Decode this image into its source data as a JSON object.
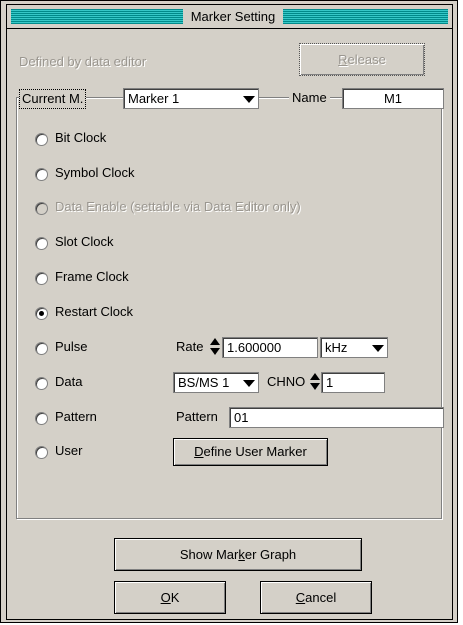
{
  "window": {
    "title": "Marker Setting"
  },
  "defined_label": "Defined by data editor",
  "release_button": {
    "prefix": "",
    "accel": "R",
    "rest": "elease"
  },
  "current_marker": {
    "label": "Current M.",
    "value": "Marker 1"
  },
  "name": {
    "label": "Name",
    "value": "M1"
  },
  "options": [
    {
      "label": "Bit Clock",
      "checked": false,
      "disabled": false
    },
    {
      "label": "Symbol Clock",
      "checked": false,
      "disabled": false
    },
    {
      "label": "Data Enable (settable via Data Editor only)",
      "checked": false,
      "disabled": true
    },
    {
      "label": "Slot Clock",
      "checked": false,
      "disabled": false
    },
    {
      "label": "Frame Clock",
      "checked": false,
      "disabled": false
    },
    {
      "label": "Restart Clock",
      "checked": true,
      "disabled": false
    },
    {
      "label": "Pulse",
      "checked": false,
      "disabled": false
    },
    {
      "label": "Data",
      "checked": false,
      "disabled": false
    },
    {
      "label": "Pattern",
      "checked": false,
      "disabled": false
    },
    {
      "label": "User",
      "checked": false,
      "disabled": false
    }
  ],
  "pulse": {
    "rate_label": "Rate",
    "rate_value": "1.600000",
    "unit": "kHz"
  },
  "data": {
    "source": "BS/MS 1",
    "chno_label": "CHNO",
    "chno_value": "1"
  },
  "pattern": {
    "label": "Pattern",
    "value": "01"
  },
  "user": {
    "button_accel": "D",
    "button_rest": "efine User Marker"
  },
  "show_graph_button": {
    "prefix": "Show Mar",
    "accel": "k",
    "rest": "er Graph"
  },
  "ok_button": {
    "prefix": "",
    "accel": "O",
    "rest": "K"
  },
  "cancel_button": {
    "prefix": "",
    "accel": "C",
    "rest": "ancel"
  }
}
